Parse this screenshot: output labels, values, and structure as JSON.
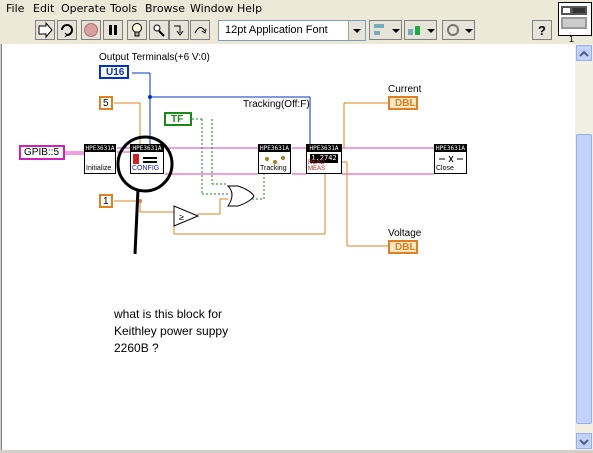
{
  "menu": [
    "File",
    "Edit",
    "Operate",
    "Tools",
    "Browse",
    "Window",
    "Help"
  ],
  "toolbar": {
    "font_select": "12pt Application Font",
    "help_icon_label": "?"
  },
  "corner": {
    "vi_number": "1"
  },
  "diagram": {
    "output_terminals_label": "Output Terminals(+6 V:0)",
    "u16_const": "U16",
    "const_5": "5",
    "const_1": "1",
    "gpib_const": "GPIB::5",
    "tf_const": "TF",
    "tracking_label": "Tracking(Off:F)",
    "current_label": "Current",
    "voltage_label": "Voltage",
    "dbl_type": "DBL",
    "nodes": {
      "initialize": {
        "header": "HPE3631A",
        "caption": "Initialize"
      },
      "config": {
        "header": "HPE3631A",
        "caption": "CONFIG"
      },
      "tracking": {
        "header": "HPE3631A",
        "caption": "Tracking"
      },
      "read_meas": {
        "header": "HPE3631A",
        "display": "1.2742",
        "caption": "READ MEAS"
      },
      "close": {
        "header": "HPE3631A",
        "caption": "Close"
      }
    },
    "annotation": [
      "what is this block for",
      "Keithley power suppy",
      "2260B ?"
    ]
  }
}
